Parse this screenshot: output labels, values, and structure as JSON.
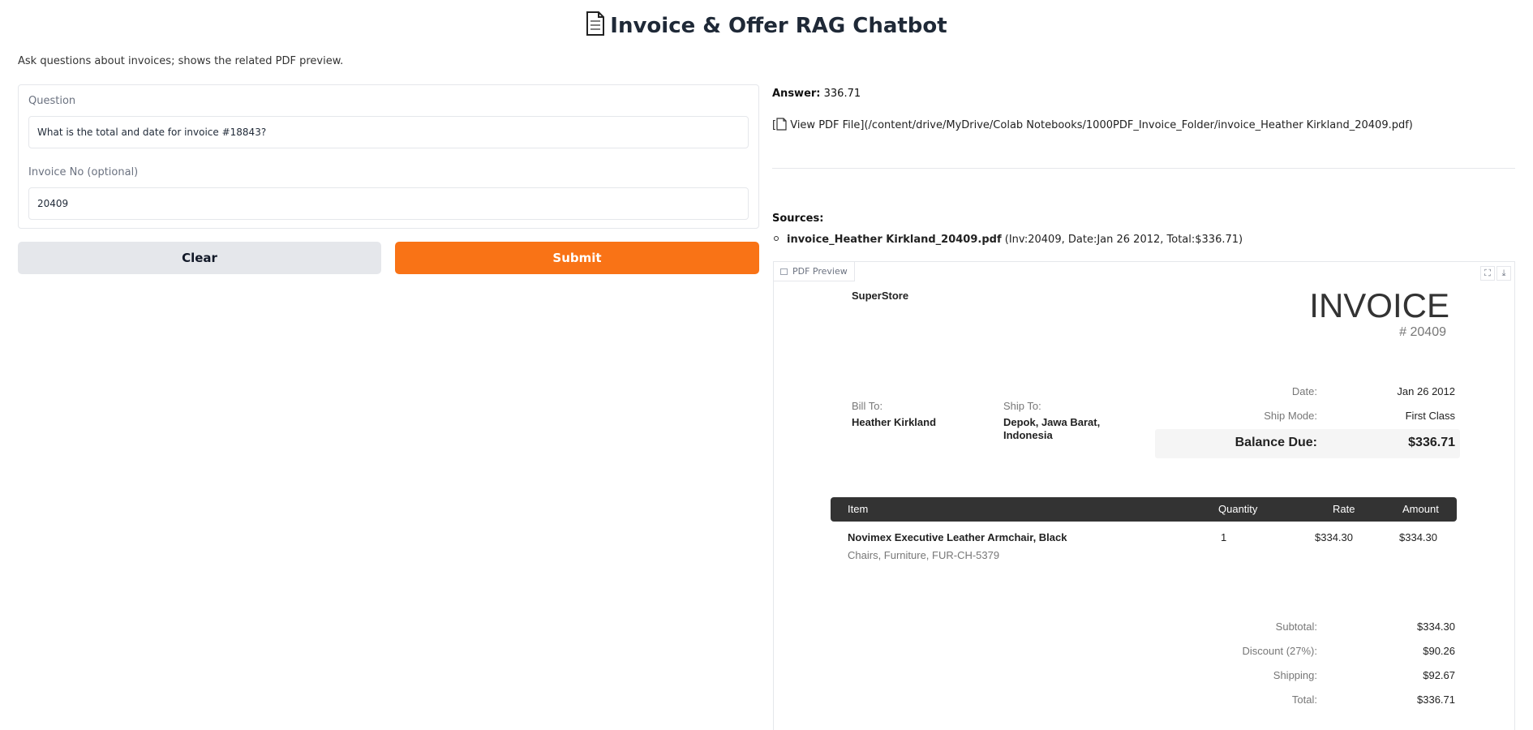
{
  "app": {
    "title": "Invoice & Offer RAG Chatbot",
    "description": "Ask questions about invoices; shows the related PDF preview."
  },
  "form": {
    "question_label": "Question",
    "question_value": "What is the total and date for invoice #18843?",
    "invoice_label": "Invoice No (optional)",
    "invoice_value": "20409",
    "clear_label": "Clear",
    "submit_label": "Submit"
  },
  "output": {
    "answer_label": "Answer:",
    "answer_value": "336.71",
    "pdf_link_open": "[",
    "pdf_link_text": " View PDF File](/content/drive/MyDrive/Colab Notebooks/1000PDF_Invoice_Folder/invoice_Heather Kirkland_20409.pdf)",
    "sources_title": "Sources:",
    "source_file": "invoice_Heather Kirkland_20409.pdf",
    "source_meta": " (Inv:20409, Date:Jan 26 2012, Total:$336.71)"
  },
  "preview": {
    "tab_label": "PDF Preview",
    "icons": [
      "fullscreen-icon",
      "download-icon"
    ],
    "accent_color": "#f97316",
    "invoice": {
      "store": "SuperStore",
      "heading": "INVOICE",
      "number": "# 20409",
      "date_label": "Date:",
      "date_value": "Jan 26 2012",
      "ship_mode_label": "Ship Mode:",
      "ship_mode_value": "First Class",
      "balance_label": "Balance Due:",
      "balance_value": "$336.71",
      "bill_to_label": "Bill To:",
      "bill_to_value": "Heather Kirkland",
      "ship_to_label": "Ship To:",
      "ship_to_value": "Depok, Jawa Barat, Indonesia",
      "columns": [
        "Item",
        "Quantity",
        "Rate",
        "Amount"
      ],
      "items": [
        {
          "name": "Novimex Executive Leather Armchair, Black",
          "desc": "Chairs, Furniture, FUR-CH-5379",
          "quantity": "1",
          "rate": "$334.30",
          "amount": "$334.30"
        }
      ],
      "subtotal_label": "Subtotal:",
      "subtotal_value": "$334.30",
      "discount_label": "Discount (27%):",
      "discount_value": "$90.26",
      "shipping_label": "Shipping:",
      "shipping_value": "$92.67",
      "total_label": "Total:",
      "total_value": "$336.71"
    }
  }
}
